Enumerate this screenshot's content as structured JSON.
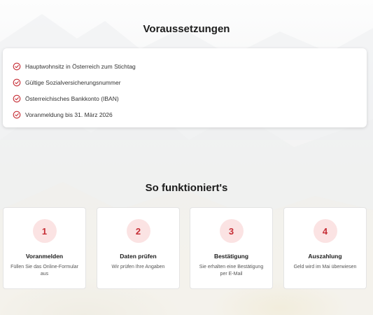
{
  "requirements": {
    "title": "Voraussetzungen",
    "items": [
      "Hauptwohnsitz in Österreich zum Stichtag",
      "Gültige Sozialversicherungsnummer",
      "Österreichisches Bankkonto (IBAN)",
      "Voranmeldung bis 31. März 2026"
    ],
    "check_icon": "check-circle-icon",
    "accent_color": "#c62d35"
  },
  "how_it_works": {
    "title": "So funktioniert's",
    "steps": [
      {
        "number": "1",
        "title": "Voranmelden",
        "description": "Füllen Sie das Online-Formular aus"
      },
      {
        "number": "2",
        "title": "Daten prüfen",
        "description": "Wir prüfen Ihre Angaben"
      },
      {
        "number": "3",
        "title": "Bestätigung",
        "description": "Sie erhalten eine Bestätigung per E-Mail"
      },
      {
        "number": "4",
        "title": "Auszahlung",
        "description": "Geld wird im Mai überwiesen"
      }
    ],
    "number_bg_color": "#fbe3e3",
    "number_color": "#c62d35"
  }
}
